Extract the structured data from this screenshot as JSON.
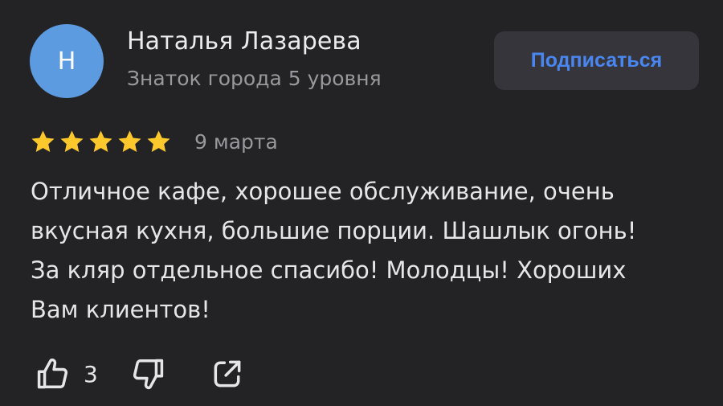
{
  "author": {
    "initial": "Н",
    "name": "Наталья Лазарева",
    "level": "Знаток города 5 уровня",
    "avatar_color": "#5d9be0"
  },
  "subscribe": {
    "label": "Подписаться",
    "color": "#4a86f0"
  },
  "review": {
    "rating": 5,
    "rating_max": 5,
    "star_color": "#fcc82c",
    "date": "9 марта",
    "text_lines": [
      "Отличное кафе, хорошее обслуживание, очень",
      "вкусная кухня, большие порции. Шашлык огонь!",
      "За кляр отдельное спасибо! Молодцы! Хороших",
      "Вам клиентов!"
    ]
  },
  "actions": {
    "likes": "3",
    "icons": [
      "thumbs-up-icon",
      "thumbs-down-icon",
      "share-icon"
    ]
  },
  "theme": {
    "background": "#232326",
    "text": "#e6e6e8",
    "muted": "#98989d"
  }
}
